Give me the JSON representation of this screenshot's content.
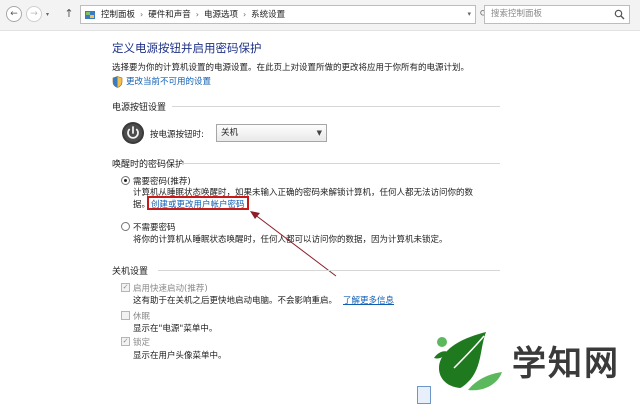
{
  "address_bar": {
    "back_glyph": "←",
    "forward_glyph": "→",
    "up_glyph": "↑",
    "breadcrumbs": [
      "控制面板",
      "硬件和声音",
      "电源选项",
      "系统设置"
    ],
    "separator": "›",
    "search_placeholder": "搜索控制面板"
  },
  "page": {
    "title": "定义电源按钮并启用密码保护",
    "description": "选择要为你的计算机设置的电源设置。在此页上对设置所做的更改将应用于你所有的电源计划。",
    "unlock_link": "更改当前不可用的设置"
  },
  "power_button_section": {
    "heading": "电源按钮设置",
    "label": "按电源按钮时:",
    "selected": "关机"
  },
  "wake_password_section": {
    "heading": "唤醒时的密码保护",
    "require": {
      "label": "需要密码(推荐)",
      "selected": true,
      "desc_line1": "计算机从睡眠状态唤醒时，如果未输入正确的密码来解锁计算机，任何人都无法访问你的数",
      "desc_line2": "据。",
      "link": "创建或更改用户帐户密码"
    },
    "not_require": {
      "label": "不需要密码",
      "selected": false,
      "desc": "将你的计算机从睡眠状态唤醒时，任何人都可以访问你的数据，因为计算机未锁定。"
    }
  },
  "shutdown_section": {
    "heading": "关机设置",
    "fast_startup": {
      "label": "启用快速启动(推荐)",
      "checked": true,
      "desc": "这有助于在关机之后更快地启动电脑。不会影响重启。",
      "link": "了解更多信息"
    },
    "sleep": {
      "label": "休眠",
      "checked": false,
      "desc": "显示在\"电源\"菜单中。"
    },
    "lock": {
      "label": "锁定",
      "checked": true,
      "desc": "显示在用户头像菜单中。"
    }
  },
  "watermark": {
    "text": "学知网",
    "colors": {
      "leaf_dark": "#1f7a1f",
      "leaf_light": "#5cb85c"
    }
  },
  "colors": {
    "title": "#1e3287",
    "link": "#0f5fb4",
    "highlight_box": "#c91a1a"
  }
}
